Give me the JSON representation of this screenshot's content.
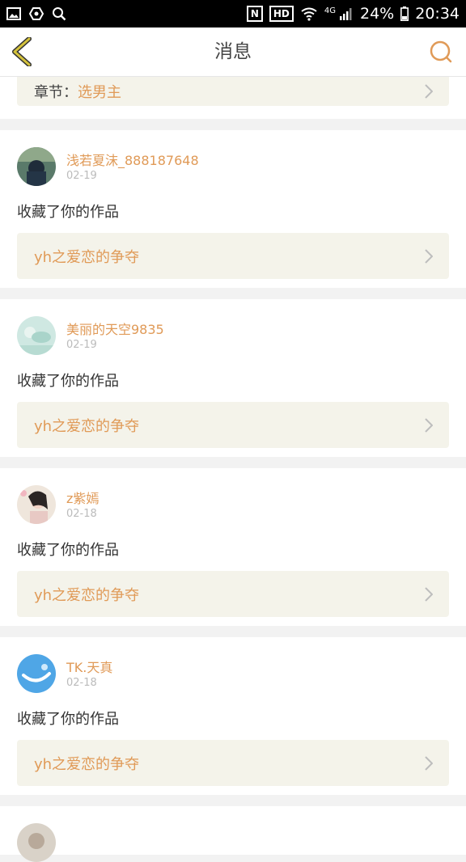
{
  "status_bar": {
    "icons_left": [
      "image-icon",
      "settings-hex-icon",
      "search-icon"
    ],
    "nfc": "N",
    "hd": "HD",
    "network": "4G",
    "battery": "24%",
    "time": "20:34"
  },
  "header": {
    "title": "消息",
    "back_icon": "chevron-left-icon",
    "search_icon": "search-icon"
  },
  "top_card": {
    "chapter_prefix": "章节：",
    "chapter_name": "选男主"
  },
  "messages": [
    {
      "user": "浅若夏沫_888187648",
      "date": "02-19",
      "action": "收藏了你的作品",
      "work": "yh之爱恋的争夺"
    },
    {
      "user": "美丽的天空9835",
      "date": "02-19",
      "action": "收藏了你的作品",
      "work": "yh之爱恋的争夺"
    },
    {
      "user": "z紫嫣",
      "date": "02-18",
      "action": "收藏了你的作品",
      "work": "yh之爱恋的争夺"
    },
    {
      "user": "TK.天真",
      "date": "02-18",
      "action": "收藏了你的作品",
      "work": "yh之爱恋的争夺"
    }
  ],
  "colors": {
    "accent": "#e09a57",
    "box_bg": "#f4f3ea",
    "back_icon": "#c9b838"
  }
}
